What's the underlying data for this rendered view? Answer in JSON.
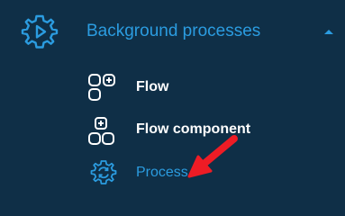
{
  "menu": {
    "section": {
      "label": "Background processes",
      "icon": "gear-play-icon",
      "expand_icon": "chevron-up-icon",
      "expanded": true
    },
    "items": [
      {
        "label": "Flow",
        "icon": "flow-icon",
        "active": false
      },
      {
        "label": "Flow component",
        "icon": "flow-component-icon",
        "active": false
      },
      {
        "label": "Process",
        "icon": "process-gear-icon",
        "active": true
      }
    ]
  },
  "annotation": {
    "icon": "red-arrow-icon",
    "color": "#ee1c25"
  },
  "colors": {
    "background": "#0f2f47",
    "accent": "#2b9ce0",
    "text": "#ffffff"
  }
}
